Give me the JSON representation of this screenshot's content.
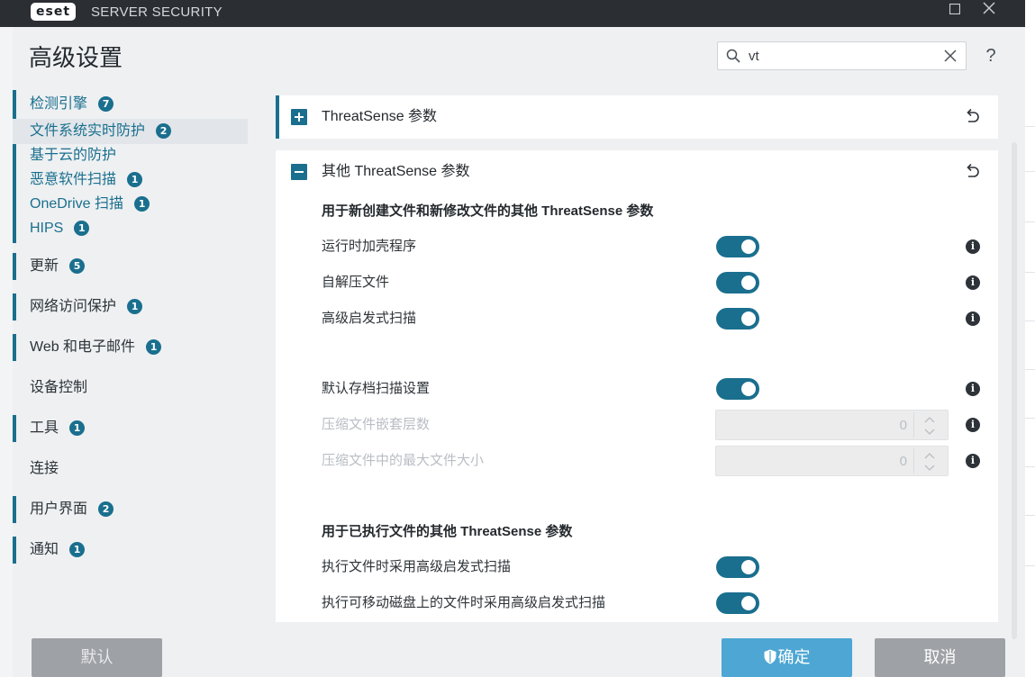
{
  "window": {
    "logo": "eset",
    "title": "SERVER SECURITY",
    "minimize_icon": "maximize-icon",
    "close_icon": "close-icon"
  },
  "header": {
    "title": "高级设置",
    "search_value": "vt",
    "help": "?"
  },
  "sidebar": {
    "items": [
      {
        "label": "检测引擎",
        "badge": "7"
      },
      {
        "label": "文件系统实时防护",
        "badge": "2"
      },
      {
        "label": "基于云的防护",
        "badge": ""
      },
      {
        "label": "恶意软件扫描",
        "badge": "1"
      },
      {
        "label": "OneDrive 扫描",
        "badge": "1"
      },
      {
        "label": "HIPS",
        "badge": "1"
      },
      {
        "label": "更新",
        "badge": "5"
      },
      {
        "label": "网络访问保护",
        "badge": "1"
      },
      {
        "label": "Web 和电子邮件",
        "badge": "1"
      },
      {
        "label": "设备控制",
        "badge": ""
      },
      {
        "label": "工具",
        "badge": "1"
      },
      {
        "label": "连接",
        "badge": ""
      },
      {
        "label": "用户界面",
        "badge": "2"
      },
      {
        "label": "通知",
        "badge": "1"
      }
    ]
  },
  "panels": {
    "collapsed_title": "ThreatSense 参数",
    "expanded_title": "其他 ThreatSense 参数",
    "section1_heading": "用于新创建文件和新修改文件的其他 ThreatSense 参数",
    "rows1": [
      {
        "label": "运行时加壳程序",
        "state": "on"
      },
      {
        "label": "自解压文件",
        "state": "on"
      },
      {
        "label": "高级启发式扫描",
        "state": "on"
      }
    ],
    "archive_default_label": "默认存档扫描设置",
    "archive_default_state": "on",
    "nesting_label": "压缩文件嵌套层数",
    "nesting_value": "0",
    "maxsize_label": "压缩文件中的最大文件大小",
    "maxsize_value": "0",
    "section2_heading": "用于已执行文件的其他 ThreatSense 参数",
    "rows2": [
      {
        "label": "执行文件时采用高级启发式扫描",
        "state": "on"
      },
      {
        "label": "执行可移动磁盘上的文件时采用高级启发式扫描",
        "state": "on"
      }
    ]
  },
  "footer": {
    "default_label": "默认",
    "ok_label": "确定",
    "cancel_label": "取消"
  },
  "colors": {
    "accent": "#1a6f8e",
    "title_bar": "#2b2e33",
    "ok_button": "#4da6d3",
    "neutral_button": "#9ea1a5"
  }
}
